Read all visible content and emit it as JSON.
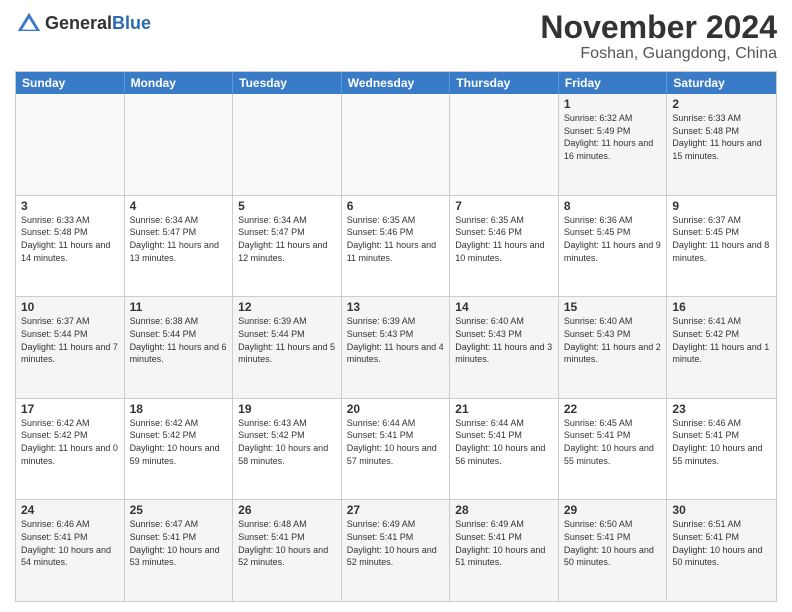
{
  "header": {
    "logo_general": "General",
    "logo_blue": "Blue",
    "month_title": "November 2024",
    "location": "Foshan, Guangdong, China"
  },
  "days_of_week": [
    "Sunday",
    "Monday",
    "Tuesday",
    "Wednesday",
    "Thursday",
    "Friday",
    "Saturday"
  ],
  "weeks": [
    [
      {
        "day": "",
        "info": ""
      },
      {
        "day": "",
        "info": ""
      },
      {
        "day": "",
        "info": ""
      },
      {
        "day": "",
        "info": ""
      },
      {
        "day": "",
        "info": ""
      },
      {
        "day": "1",
        "info": "Sunrise: 6:32 AM\nSunset: 5:49 PM\nDaylight: 11 hours and 16 minutes."
      },
      {
        "day": "2",
        "info": "Sunrise: 6:33 AM\nSunset: 5:48 PM\nDaylight: 11 hours and 15 minutes."
      }
    ],
    [
      {
        "day": "3",
        "info": "Sunrise: 6:33 AM\nSunset: 5:48 PM\nDaylight: 11 hours and 14 minutes."
      },
      {
        "day": "4",
        "info": "Sunrise: 6:34 AM\nSunset: 5:47 PM\nDaylight: 11 hours and 13 minutes."
      },
      {
        "day": "5",
        "info": "Sunrise: 6:34 AM\nSunset: 5:47 PM\nDaylight: 11 hours and 12 minutes."
      },
      {
        "day": "6",
        "info": "Sunrise: 6:35 AM\nSunset: 5:46 PM\nDaylight: 11 hours and 11 minutes."
      },
      {
        "day": "7",
        "info": "Sunrise: 6:35 AM\nSunset: 5:46 PM\nDaylight: 11 hours and 10 minutes."
      },
      {
        "day": "8",
        "info": "Sunrise: 6:36 AM\nSunset: 5:45 PM\nDaylight: 11 hours and 9 minutes."
      },
      {
        "day": "9",
        "info": "Sunrise: 6:37 AM\nSunset: 5:45 PM\nDaylight: 11 hours and 8 minutes."
      }
    ],
    [
      {
        "day": "10",
        "info": "Sunrise: 6:37 AM\nSunset: 5:44 PM\nDaylight: 11 hours and 7 minutes."
      },
      {
        "day": "11",
        "info": "Sunrise: 6:38 AM\nSunset: 5:44 PM\nDaylight: 11 hours and 6 minutes."
      },
      {
        "day": "12",
        "info": "Sunrise: 6:39 AM\nSunset: 5:44 PM\nDaylight: 11 hours and 5 minutes."
      },
      {
        "day": "13",
        "info": "Sunrise: 6:39 AM\nSunset: 5:43 PM\nDaylight: 11 hours and 4 minutes."
      },
      {
        "day": "14",
        "info": "Sunrise: 6:40 AM\nSunset: 5:43 PM\nDaylight: 11 hours and 3 minutes."
      },
      {
        "day": "15",
        "info": "Sunrise: 6:40 AM\nSunset: 5:43 PM\nDaylight: 11 hours and 2 minutes."
      },
      {
        "day": "16",
        "info": "Sunrise: 6:41 AM\nSunset: 5:42 PM\nDaylight: 11 hours and 1 minute."
      }
    ],
    [
      {
        "day": "17",
        "info": "Sunrise: 6:42 AM\nSunset: 5:42 PM\nDaylight: 11 hours and 0 minutes."
      },
      {
        "day": "18",
        "info": "Sunrise: 6:42 AM\nSunset: 5:42 PM\nDaylight: 10 hours and 59 minutes."
      },
      {
        "day": "19",
        "info": "Sunrise: 6:43 AM\nSunset: 5:42 PM\nDaylight: 10 hours and 58 minutes."
      },
      {
        "day": "20",
        "info": "Sunrise: 6:44 AM\nSunset: 5:41 PM\nDaylight: 10 hours and 57 minutes."
      },
      {
        "day": "21",
        "info": "Sunrise: 6:44 AM\nSunset: 5:41 PM\nDaylight: 10 hours and 56 minutes."
      },
      {
        "day": "22",
        "info": "Sunrise: 6:45 AM\nSunset: 5:41 PM\nDaylight: 10 hours and 55 minutes."
      },
      {
        "day": "23",
        "info": "Sunrise: 6:46 AM\nSunset: 5:41 PM\nDaylight: 10 hours and 55 minutes."
      }
    ],
    [
      {
        "day": "24",
        "info": "Sunrise: 6:46 AM\nSunset: 5:41 PM\nDaylight: 10 hours and 54 minutes."
      },
      {
        "day": "25",
        "info": "Sunrise: 6:47 AM\nSunset: 5:41 PM\nDaylight: 10 hours and 53 minutes."
      },
      {
        "day": "26",
        "info": "Sunrise: 6:48 AM\nSunset: 5:41 PM\nDaylight: 10 hours and 52 minutes."
      },
      {
        "day": "27",
        "info": "Sunrise: 6:49 AM\nSunset: 5:41 PM\nDaylight: 10 hours and 52 minutes."
      },
      {
        "day": "28",
        "info": "Sunrise: 6:49 AM\nSunset: 5:41 PM\nDaylight: 10 hours and 51 minutes."
      },
      {
        "day": "29",
        "info": "Sunrise: 6:50 AM\nSunset: 5:41 PM\nDaylight: 10 hours and 50 minutes."
      },
      {
        "day": "30",
        "info": "Sunrise: 6:51 AM\nSunset: 5:41 PM\nDaylight: 10 hours and 50 minutes."
      }
    ]
  ]
}
